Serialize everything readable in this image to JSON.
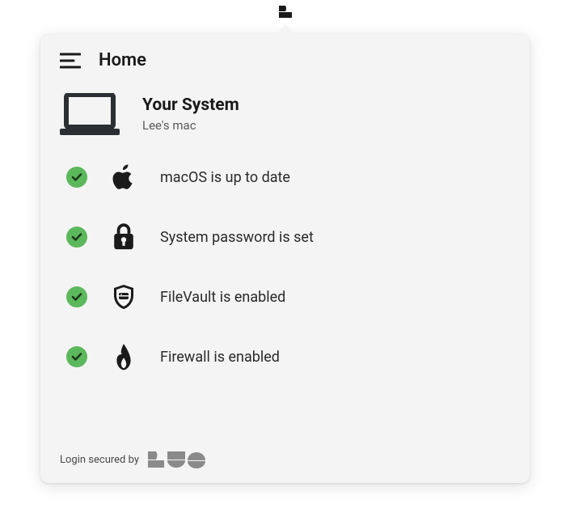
{
  "header": {
    "title": "Home"
  },
  "system": {
    "title": "Your System",
    "subtitle": "Lee's mac"
  },
  "status_items": [
    {
      "icon": "apple-icon",
      "label": "macOS is up to date",
      "ok": true
    },
    {
      "icon": "lock-icon",
      "label": "System password is set",
      "ok": true
    },
    {
      "icon": "shield-icon",
      "label": "FileVault is enabled",
      "ok": true
    },
    {
      "icon": "flame-icon",
      "label": "Firewall is enabled",
      "ok": true
    }
  ],
  "footer": {
    "text": "Login secured by"
  }
}
